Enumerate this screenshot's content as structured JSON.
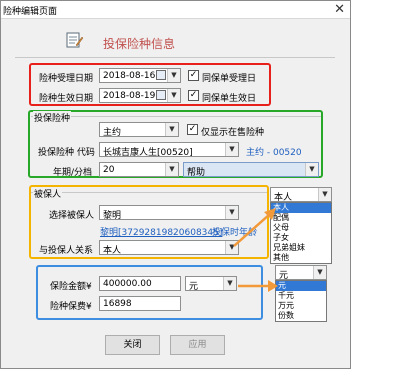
{
  "window": {
    "title": "险种编辑页面",
    "close_glyph": "✕"
  },
  "header": {
    "title": "投保险种信息",
    "icon": "edit-document-icon"
  },
  "dates": {
    "accept_label": "险种受理日期",
    "accept_value": "2018-08-16",
    "accept_same_label": "同保单受理日",
    "accept_same_checked": true,
    "effective_label": "险种生效日期",
    "effective_value": "2018-08-19",
    "effective_same_label": "同保单生效日",
    "effective_same_checked": true
  },
  "insured_policy": {
    "group_title": "投保险种",
    "type_value": "主约",
    "only_show_label": "仅显示在售险种",
    "only_show_checked": true,
    "code_label": "投保险种 代码",
    "code_value": "长城吉康人生[00520]",
    "code_note": "主约 - 00520",
    "period_label": "年期/分档",
    "period_value": "20",
    "help_value": "帮助"
  },
  "insured": {
    "group_title": "被保人",
    "select_label": "选择被保人",
    "select_value": "黎明",
    "id_link": "黎明[37292819820608345]",
    "age_note": "投保时年龄",
    "relation_label": "与投保人关系",
    "relation_value": "本人"
  },
  "relation_dropdown": {
    "selected": "本人",
    "options": [
      "本人",
      "配偶",
      "父母",
      "子女",
      "兄弟姐妹",
      "其他"
    ],
    "highlighted_index": 0
  },
  "amounts": {
    "amount_label": "保险金额¥",
    "amount_value": "400000.00",
    "unit_value": "元",
    "premium_label": "险种保费¥",
    "premium_value": "16898"
  },
  "unit_dropdown": {
    "selected": "元",
    "options": [
      "元",
      "千元",
      "万元",
      "份数"
    ],
    "highlighted_index": 0
  },
  "buttons": {
    "close_label": "关闭",
    "apply_label": "应用"
  },
  "colors": {
    "red": "#e8201c",
    "green": "#28a828",
    "orange": "#f4b400",
    "blue": "#3d8de0",
    "header_red": "#c0504d",
    "highlight": "#3179d4"
  }
}
